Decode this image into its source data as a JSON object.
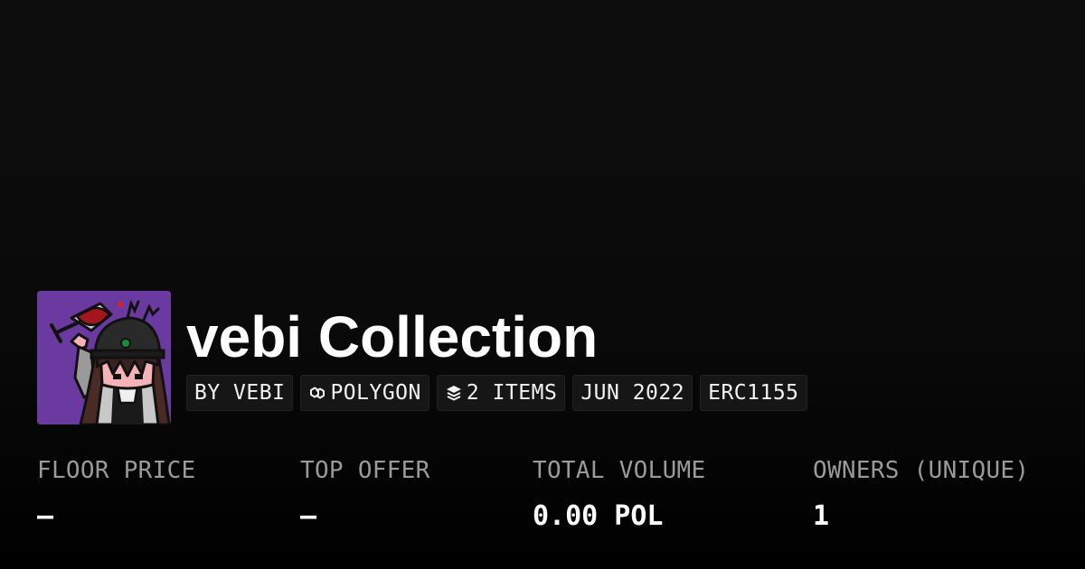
{
  "collection": {
    "title": "vebi Collection",
    "avatar_bg": "#6b3aa0"
  },
  "tags": [
    {
      "label": "BY VEBI",
      "icon": ""
    },
    {
      "label": "POLYGON",
      "icon": "polygon-icon"
    },
    {
      "label": "2 ITEMS",
      "icon": "layers-icon"
    },
    {
      "label": "JUN 2022",
      "icon": ""
    },
    {
      "label": "ERC1155",
      "icon": ""
    }
  ],
  "stats": [
    {
      "label": "FLOOR PRICE",
      "value": "–"
    },
    {
      "label": "TOP OFFER",
      "value": "–"
    },
    {
      "label": "TOTAL VOLUME",
      "value": "0.00 POL"
    },
    {
      "label": "OWNERS (UNIQUE)",
      "value": "1"
    }
  ],
  "colors": {
    "background": "#0a0a0a",
    "tag_bg": "#161616",
    "label_gray": "#9a9a9a",
    "text_white": "#ffffff"
  }
}
